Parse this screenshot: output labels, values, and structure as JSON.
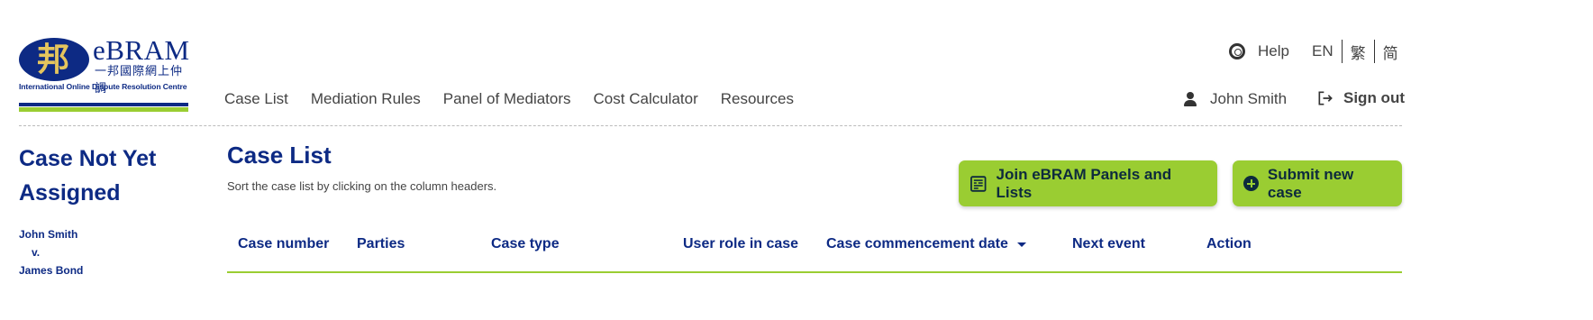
{
  "logo": {
    "brand": "eBRAM",
    "brand_cn": "一邦國際網上仲調",
    "tagline": "International Online Dispute Resolution Centre",
    "emblem_glyph": "邦"
  },
  "header": {
    "help_label": "Help",
    "languages": [
      "EN",
      "繁",
      "简"
    ],
    "nav": [
      "Case List",
      "Mediation Rules",
      "Panel of Mediators",
      "Cost Calculator",
      "Resources"
    ],
    "user_name": "John Smith",
    "signout_label": "Sign out"
  },
  "sidebar": {
    "case_title": "Case Not Yet Assigned",
    "party_a": "John Smith",
    "versus": "v.",
    "party_b": "James Bond"
  },
  "main": {
    "title": "Case List",
    "subtitle": "Sort the case list by clicking on the column headers.",
    "join_button": "Join eBRAM Panels and Lists",
    "submit_button": "Submit new case",
    "columns": [
      "Case number",
      "Parties",
      "Case type",
      "User role in case",
      "Case commencement date",
      "Next event",
      "Action"
    ],
    "sorted_column": "Case commencement date"
  },
  "colors": {
    "brand_blue": "#0d2a84",
    "accent_green": "#9acd32"
  },
  "icons": {
    "help": "lifebuoy-icon",
    "user": "person-icon",
    "signout": "exit-icon",
    "join": "form-icon",
    "submit": "plus-circle-icon",
    "sort": "caret-down-icon"
  }
}
